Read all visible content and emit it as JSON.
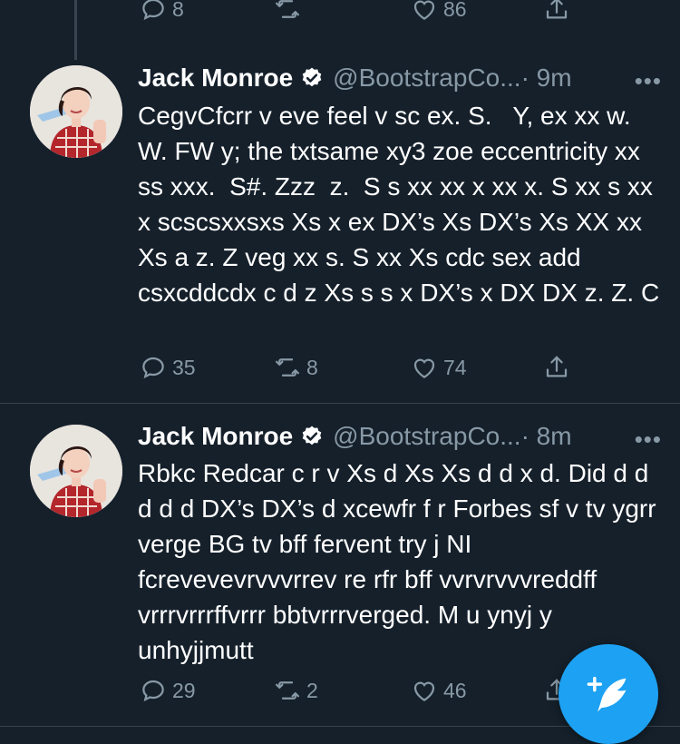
{
  "prev_tweet": {
    "reply_count": "8",
    "like_count": "86"
  },
  "tweets": [
    {
      "name": "Jack Monroe",
      "handle": "@BootstrapCo...",
      "time": "· 9m",
      "more": "•••",
      "text": "CegvCfcrr v eve feel v sc ex. S.   Y, ex xx w.  W. FW y; the txtsame xy3 zoe eccentricity xx ss xxx.  S#. Zzz  z.  S s xx xx x xx x. S xx s xx x scscsxxsxs Xs x ex DX’s Xs DX’s Xs XX xx Xs a z. Z veg xx s. S xx Xs cdc sex add csxcddcdx c d z Xs s s x DX’s x DX DX z. Z. C",
      "reply_count": "35",
      "retweet_count": "8",
      "like_count": "74"
    },
    {
      "name": "Jack Monroe",
      "handle": "@BootstrapCo...",
      "time": "· 8m",
      "more": "•••",
      "text": "Rbkc Redcar c r v Xs d Xs Xs d d x d. Did d d d d d DX’s DX’s d xcewfr f r Forbes sf v tv ygrr verge BG tv bff fervent try j NI fcrevevevrvvvrrev re rfr bff vvrvrvvvreddff vrrrvrrrffvrrr bbtvrrrverged. M u ynyj y unhyjjmutt",
      "reply_count": "29",
      "retweet_count": "2",
      "like_count": "46"
    }
  ],
  "colors": {
    "background": "#15202b",
    "secondary_text": "#8899a6",
    "accent": "#1da1f2"
  }
}
